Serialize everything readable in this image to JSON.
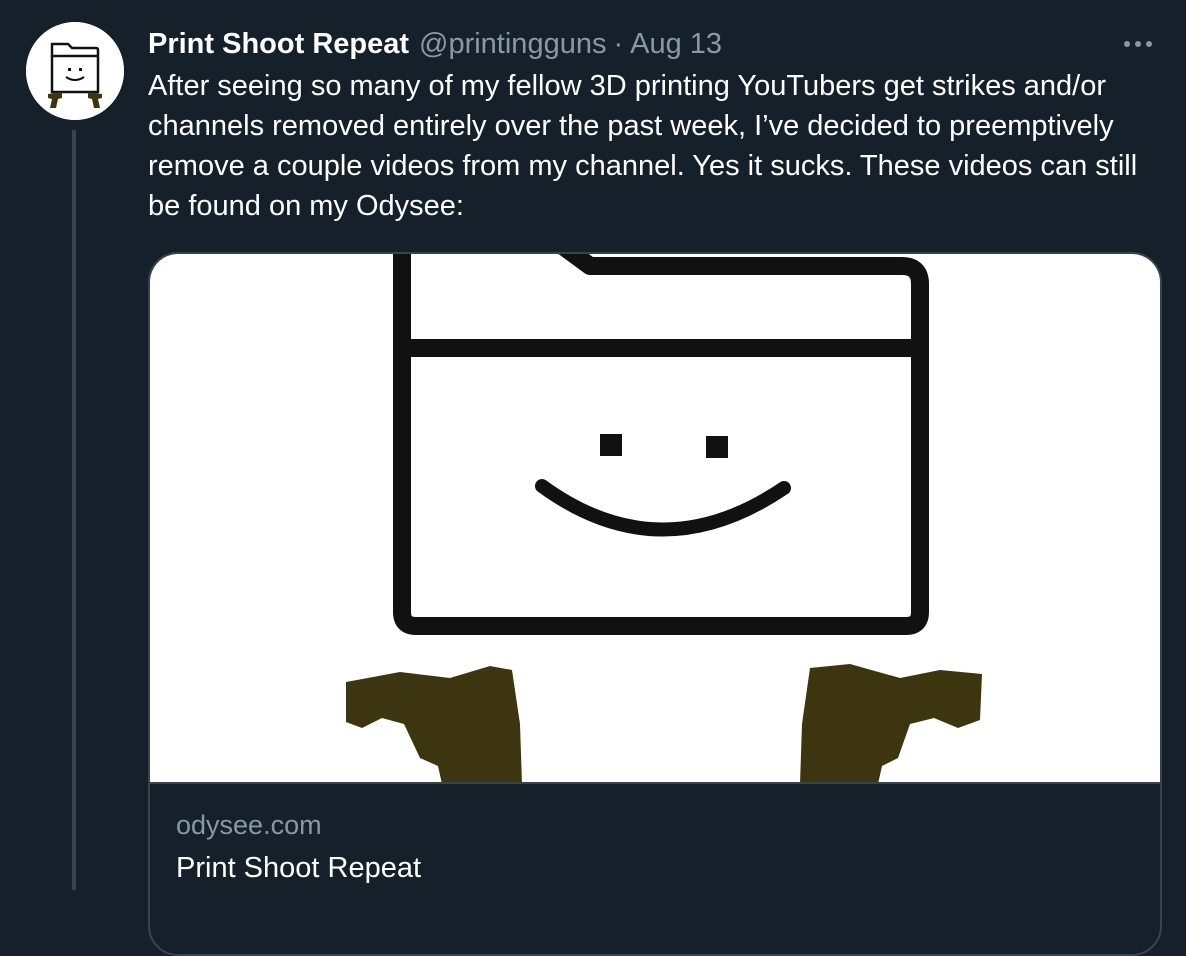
{
  "tweet": {
    "display_name": "Print Shoot Repeat",
    "handle": "@printingguns",
    "separator": "·",
    "date": "Aug 13",
    "text": "After seeing so many of my fellow 3D printing YouTubers get strikes and/or channels removed entirely over the past week, I’ve decided to preemptively remove a couple videos from my channel. Yes it sucks. These videos can still be found on my Odysee:"
  },
  "card": {
    "domain": "odysee.com",
    "title": "Print Shoot Repeat"
  },
  "icons": {
    "more": "more-horizontal-icon",
    "avatar": "smiling-folder-with-guns"
  },
  "colors": {
    "background": "#15202b",
    "secondary_text": "#8899a6",
    "border": "#38444d",
    "gun": "#3d3410"
  }
}
